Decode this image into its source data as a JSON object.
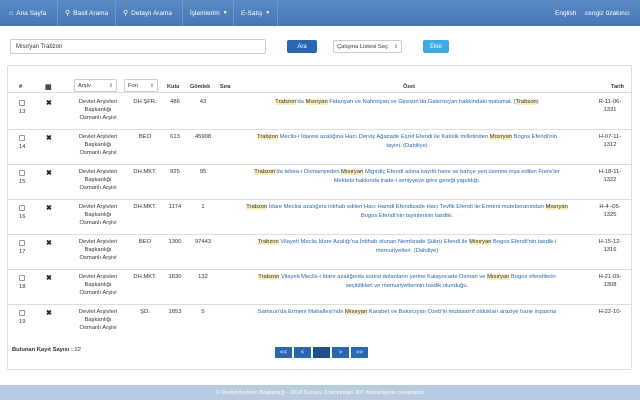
{
  "nav": {
    "home": "Ana Sayfa",
    "basic_search": "Basit Arama",
    "detailed_search": "Detaylı Arama",
    "operations": "İşlemlerim",
    "esatis": "E-Satış",
    "language": "English",
    "user": "cengiz özakıncı"
  },
  "search": {
    "query": "Mısıryan Trabzon",
    "button": "Ara",
    "worklist": "Çalışma Listesi Seç",
    "add_button": "Ekle"
  },
  "table": {
    "headers": {
      "num": "#",
      "archive": "Arşiv",
      "fon": "Fon",
      "kutu": "Kutu",
      "gomlek": "Gömlek",
      "sira": "Sıra",
      "ozet": "Özet",
      "tarih": "Tarih"
    },
    "rows": [
      {
        "num": "13",
        "archive": [
          "Devlet Arşivleri",
          "Başkanlığı",
          "Osmanlı Arşivi"
        ],
        "fon": "DH.ŞFR.",
        "kutu": "486",
        "gomlek": "43",
        "sira": "",
        "ozet": [
          [
            [
              "Trabzon",
              true
            ],
            [
              "'da ",
              false
            ],
            [
              "Mısıryan",
              true
            ],
            [
              " Fidanyan ve Nahroiyan ve Giresun'da Galerosyan hakkındaki malumat. (",
              false
            ],
            [
              "Trabzon",
              true
            ],
            [
              ")",
              false
            ]
          ]
        ],
        "tarih": [
          "R-11-06-",
          "1331"
        ]
      },
      {
        "num": "14",
        "archive": [
          "Devlet Arşivleri",
          "Başkanlığı",
          "Osmanlı Arşivi"
        ],
        "fon": "BEO",
        "kutu": "613",
        "gomlek": "45908",
        "sira": "",
        "ozet": [
          [
            [
              "Trabzon",
              true
            ],
            [
              " Meclis-i İdaresi azalığına Hacı Derviş Ağazade Eşref Efendi ile Katolik milletinden ",
              false
            ],
            [
              "Mısıryan",
              true
            ],
            [
              " Bogos Efendi'nin",
              false
            ]
          ],
          [
            [
              "tayini. (Dahiliye)",
              false
            ]
          ]
        ],
        "tarih": [
          "H-07-11-",
          "1312"
        ]
      },
      {
        "num": "15",
        "archive": [
          "Devlet Arşivleri",
          "Başkanlığı",
          "Osmanlı Arşivi"
        ],
        "fon": "DH.MKT.",
        "kutu": "925",
        "gomlek": "95",
        "sira": "",
        "ozet": [
          [
            [
              "Trabzon",
              true
            ],
            [
              "'da tebea-i Osmaniyeden ",
              false
            ],
            [
              "Mısıryan",
              true
            ],
            [
              " Migırdiç Efendi adına kayıtlı hane ve bahçe yeri üzerine inşa edilen Frere'ler",
              false
            ]
          ],
          [
            [
              "Mektebi hakkında irade-i seniyyeye göre gereği yapıldığı.",
              false
            ]
          ]
        ],
        "tarih": [
          "H-18-11-",
          "1322"
        ]
      },
      {
        "num": "16",
        "archive": [
          "Devlet Arşivleri",
          "Başkanlığı",
          "Osmanlı Arşivi"
        ],
        "fon": "DH.MKT.",
        "kutu": "1174",
        "gomlek": "1",
        "sira": "",
        "ozet": [
          [
            [
              "Trabzon",
              true
            ],
            [
              " İdare Meclisi azalığına intihab edilen Hacı Hamdi Efendizade Hacı Tevfik Efendi ile Ermeni muteberanından ",
              false
            ],
            [
              "Mısıryan",
              true
            ]
          ],
          [
            [
              "Bogos Efendi'nin tayinlerinin tasdiki.",
              false
            ]
          ]
        ],
        "tarih": [
          "H-4 -05-",
          "1325"
        ]
      },
      {
        "num": "17",
        "archive": [
          "Devlet Arşivleri",
          "Başkanlığı",
          "Osmanlı Arşivi"
        ],
        "fon": "BEO",
        "kutu": "1300",
        "gomlek": "97443",
        "sira": "",
        "ozet": [
          [
            [
              "Trabzon",
              true
            ],
            [
              " Vilayeti Meclis İdare Azalığı'na İntihab olunan Nemlizade Şükrü Efendi ile ",
              false
            ],
            [
              "Mısıryan",
              true
            ],
            [
              " Bogos Efendi'nin tasdik-i",
              false
            ]
          ],
          [
            [
              "memuriyetleri. (Dahiliye)",
              false
            ]
          ]
        ],
        "tarih": [
          "H-15-12-",
          "1316"
        ]
      },
      {
        "num": "18",
        "archive": [
          "Devlet Arşivleri",
          "Başkanlığı",
          "Osmanlı Arşivi"
        ],
        "fon": "DH.MKT.",
        "kutu": "1830",
        "gomlek": "132",
        "sira": "",
        "ozet": [
          [
            [
              "Trabzon",
              true
            ],
            [
              " Vilayeti Meclis-i İdare azalığında süresi dolanların yerine Kalayocade Osman ve ",
              false
            ],
            [
              "Mısıryan",
              true
            ],
            [
              " Bogos efendilerin",
              false
            ]
          ],
          [
            [
              "seçildikleri ve memuriyetlerinin tasdik olunduğu.",
              false
            ]
          ]
        ],
        "tarih": [
          "H-21-09-",
          "1308"
        ]
      },
      {
        "num": "19",
        "archive": [
          "Devlet Arşivleri",
          "Başkanlığı",
          "Osmanlı Arşivi"
        ],
        "fon": "ŞD.",
        "kutu": "1853",
        "gomlek": "5",
        "sira": "",
        "ozet": [
          [
            [
              "Samsun'da Ermeni Mahallesi'nde ",
              false
            ],
            [
              "Mısıryan",
              true
            ],
            [
              " Karabet ve Bakırcıyan Ozeb'in mutasarrıf oldukları araziye hane inşasına",
              false
            ]
          ]
        ],
        "tarih": [
          "H-22-10-",
          ""
        ]
      }
    ]
  },
  "result": {
    "label": "Bulunan Kayıt Sayısı : ",
    "count": "22"
  },
  "pagination": [
    "<<",
    "<",
    "",
    ">",
    ">>"
  ],
  "footer": "© Devlet Arşivleri Başkanlığı - 2018 Sunucu 3 tarafından 307 milisaniyede cevaplandı"
}
